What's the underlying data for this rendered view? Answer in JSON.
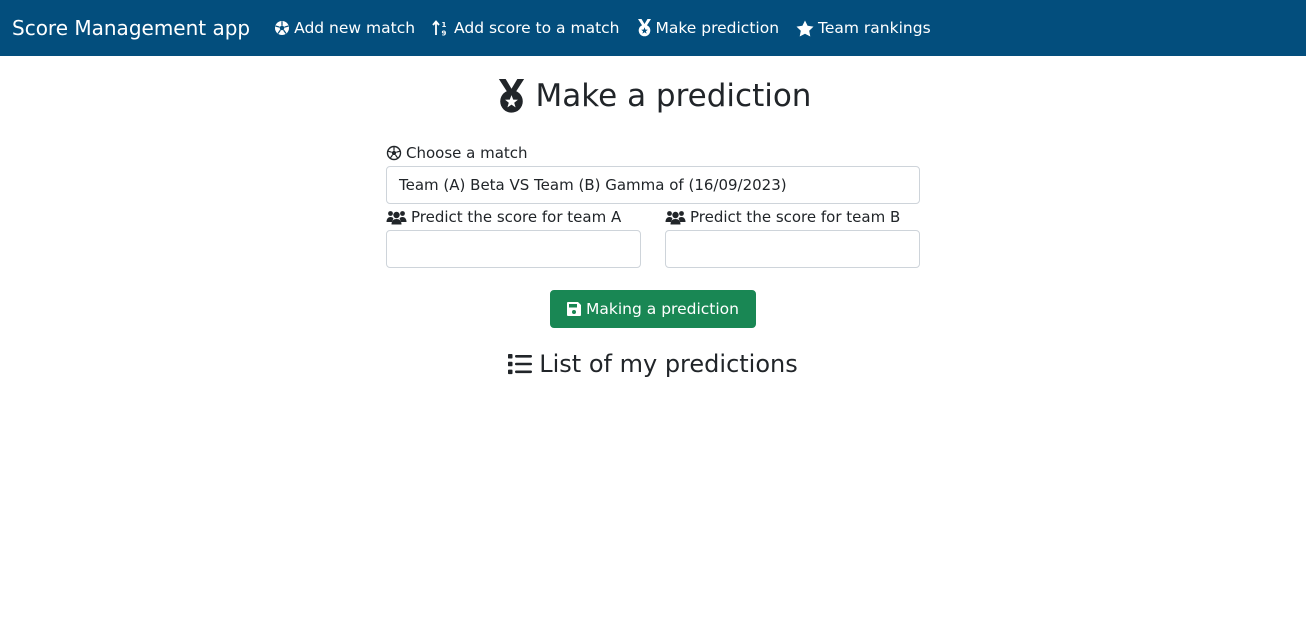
{
  "navbar": {
    "brand": "Score Management app",
    "links": [
      {
        "label": "Add new match",
        "icon": "futbol-icon"
      },
      {
        "label": "Add score to a match",
        "icon": "sort-numeric-icon"
      },
      {
        "label": "Make prediction",
        "icon": "medal-icon"
      },
      {
        "label": "Team rankings",
        "icon": "star-icon"
      }
    ],
    "background_color": "#034e7d"
  },
  "main": {
    "title": "Make a prediction",
    "title_icon": "medal-icon"
  },
  "form": {
    "match_label": "Choose a match",
    "match_selected": "Team (A) Beta VS Team (B) Gamma of (16/09/2023)",
    "team_a_label": "Predict the score for team A",
    "team_a_value": "",
    "team_b_label": "Predict the score for team B",
    "team_b_value": "",
    "submit_label": "Making a prediction",
    "submit_color": "#198754"
  },
  "predictions": {
    "title": "List of my predictions",
    "title_icon": "list-icon",
    "items": []
  }
}
